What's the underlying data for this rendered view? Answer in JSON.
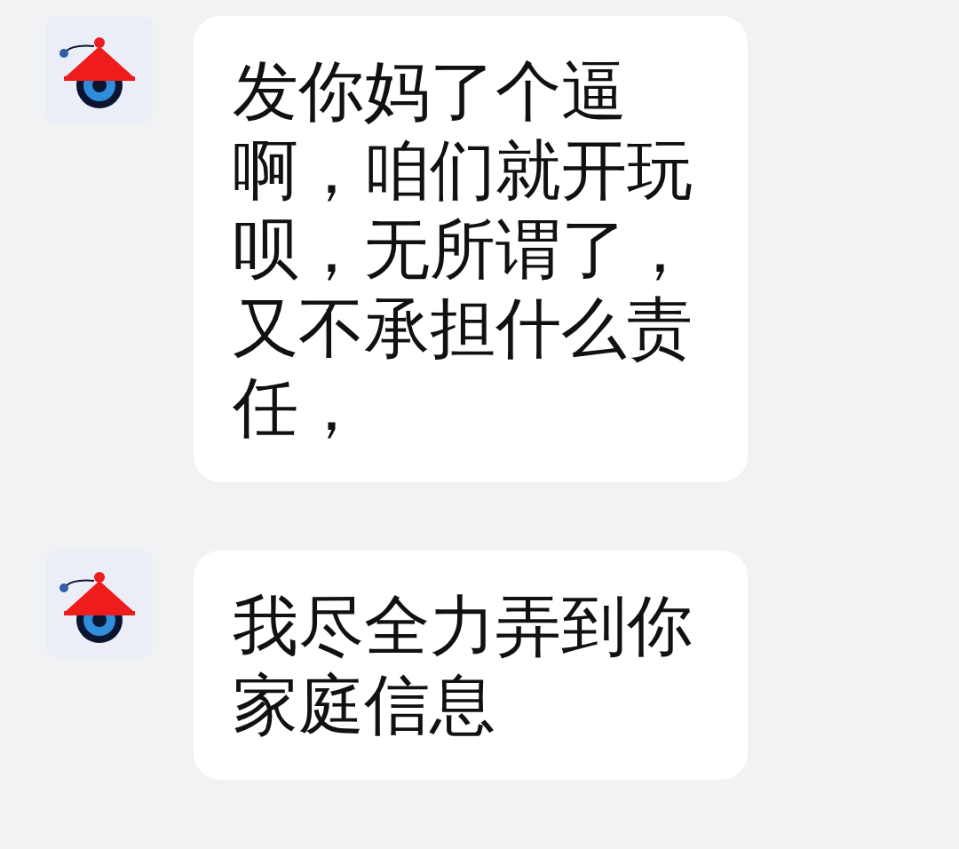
{
  "messages": [
    {
      "text": "发你妈了个逼啊，咱们就开玩呗，无所谓了，又不承担什么责任，"
    },
    {
      "text": "我尽全力弄到你家庭信息"
    }
  ]
}
